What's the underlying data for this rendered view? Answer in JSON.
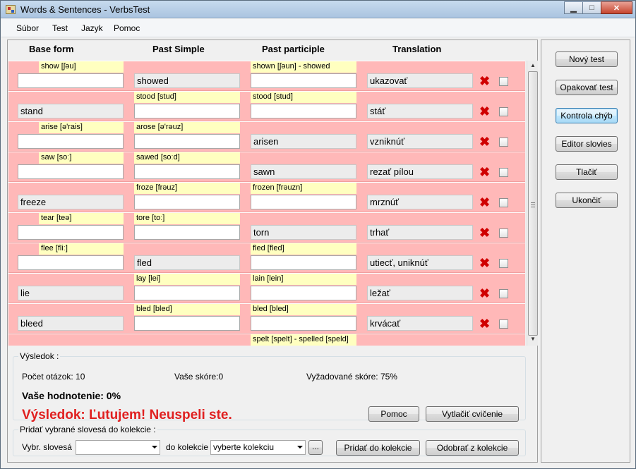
{
  "window": {
    "title": "Words & Sentences - VerbsTest",
    "minimize": "▁",
    "maximize": "□",
    "close": "✕"
  },
  "menu": [
    "Súbor",
    "Test",
    "Jazyk",
    "Pomoc"
  ],
  "columns": {
    "base": "Base form",
    "past": "Past Simple",
    "participle": "Past participle",
    "translation": "Translation"
  },
  "rows": [
    {
      "c1": {
        "hint": "show [ʃəu]",
        "value": "",
        "filled": false
      },
      "c2": {
        "hint": "",
        "value": "showed",
        "filled": true
      },
      "c3": {
        "hint": "shown [ʃəun] - showed",
        "value": "",
        "filled": false
      },
      "translation": "ukazovať"
    },
    {
      "c1": {
        "hint": "",
        "value": "stand",
        "filled": true
      },
      "c2": {
        "hint": "stood [stud]",
        "value": "",
        "filled": false
      },
      "c3": {
        "hint": "stood [stud]",
        "value": "",
        "filled": false
      },
      "translation": "stáť"
    },
    {
      "c1": {
        "hint": "arise [ə'rais]",
        "value": "",
        "filled": false
      },
      "c2": {
        "hint": "arose [ə'rəuz]",
        "value": "",
        "filled": false
      },
      "c3": {
        "hint": "",
        "value": "arisen",
        "filled": true
      },
      "translation": "vzniknúť"
    },
    {
      "c1": {
        "hint": "saw [soː]",
        "value": "",
        "filled": false
      },
      "c2": {
        "hint": "sawed [soːd]",
        "value": "",
        "filled": false
      },
      "c3": {
        "hint": "",
        "value": "sawn",
        "filled": true
      },
      "translation": "rezať pílou"
    },
    {
      "c1": {
        "hint": "",
        "value": "freeze",
        "filled": true
      },
      "c2": {
        "hint": "froze [frəuz]",
        "value": "",
        "filled": false
      },
      "c3": {
        "hint": "frozen [frəuzn]",
        "value": "",
        "filled": false
      },
      "translation": "mrznúť"
    },
    {
      "c1": {
        "hint": "tear [teə]",
        "value": "",
        "filled": false
      },
      "c2": {
        "hint": "tore [toː]",
        "value": "",
        "filled": false
      },
      "c3": {
        "hint": "",
        "value": "torn",
        "filled": true
      },
      "translation": "trhať"
    },
    {
      "c1": {
        "hint": "flee [fliː]",
        "value": "",
        "filled": false
      },
      "c2": {
        "hint": "",
        "value": "fled",
        "filled": true
      },
      "c3": {
        "hint": "fled [fled]",
        "value": "",
        "filled": false
      },
      "translation": "utiecť, uniknúť"
    },
    {
      "c1": {
        "hint": "",
        "value": "lie",
        "filled": true
      },
      "c2": {
        "hint": "lay [lei]",
        "value": "",
        "filled": false
      },
      "c3": {
        "hint": "lain [lein]",
        "value": "",
        "filled": false
      },
      "translation": "ležať"
    },
    {
      "c1": {
        "hint": "",
        "value": "bleed",
        "filled": true
      },
      "c2": {
        "hint": "bled [bled]",
        "value": "",
        "filled": false
      },
      "c3": {
        "hint": "bled [bled]",
        "value": "",
        "filled": false
      },
      "translation": "krvácať"
    },
    {
      "c1": {
        "hint": "",
        "value": "",
        "filled": false
      },
      "c2": {
        "hint": "",
        "value": "",
        "filled": false
      },
      "c3": {
        "hint": "spelt [spelt] - spelled [speld]",
        "value": "",
        "filled": false
      },
      "translation": ""
    }
  ],
  "delete_icon": "✖",
  "result": {
    "legend": "Výsledok :",
    "questions": "Počet otázok: 10",
    "score": "Vaše skóre:0",
    "required": "Vyžadované skóre: 75%",
    "rating": "Vaše hodnotenie: 0%",
    "message": "Výsledok: Ľutujem! Neuspeli ste.",
    "message_color": "#e02020",
    "help_button": "Pomoc",
    "print_button": "Vytlačiť cvičenie"
  },
  "collection": {
    "legend": "Pridať vybrané slovesá do kolekcie :",
    "verbs_label": "Vybr. slovesá",
    "verbs_value": "",
    "to_label": "do kolekcie",
    "collection_value": "vyberte kolekciu",
    "browse_button": "...",
    "add_button": "Pridať do kolekcie",
    "remove_button": "Odobrať z kolekcie"
  },
  "side_buttons": [
    "Nový test",
    "Opakovať test",
    "Kontrola chýb",
    "Editor slovies",
    "Tlačiť",
    "Ukončiť"
  ]
}
